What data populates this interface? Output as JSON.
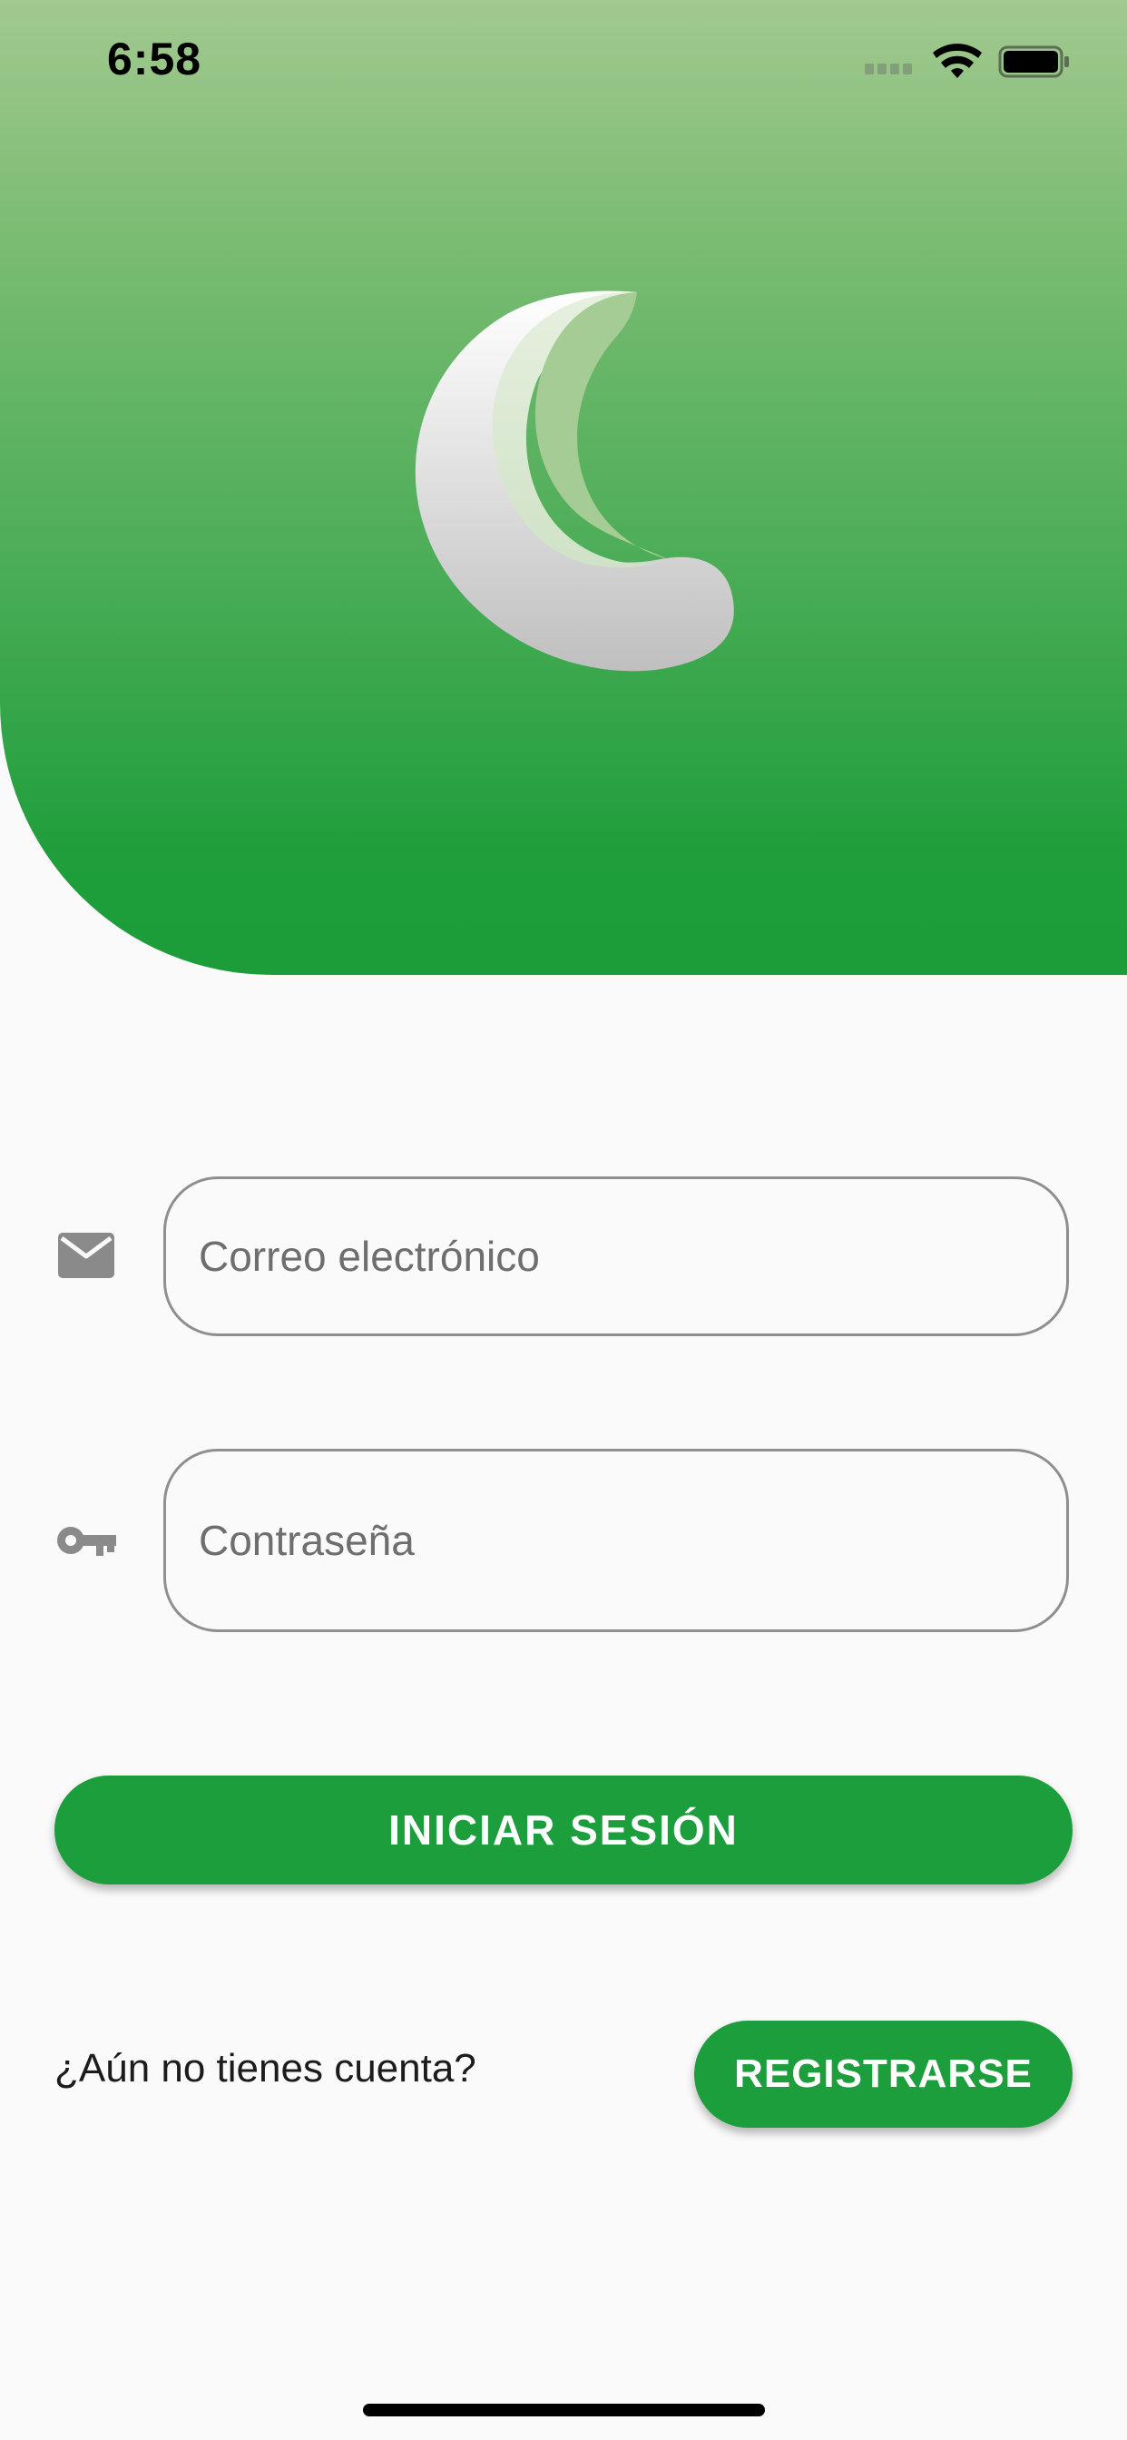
{
  "status_bar": {
    "time": "6:58",
    "icons": [
      "cellular-signal-icon",
      "wifi-icon",
      "battery-icon"
    ]
  },
  "header": {
    "logo": "crescent-moon-logo",
    "gradient_colors": [
      "#a2c98f",
      "#1c9d3a"
    ]
  },
  "form": {
    "email": {
      "icon": "mail-icon",
      "placeholder": "Correo electrónico",
      "value": ""
    },
    "password": {
      "icon": "key-icon",
      "placeholder": "Contraseña",
      "value": ""
    },
    "login_label": "INICIAR SESIÓN"
  },
  "signup": {
    "prompt": "¿Aún no tienes cuenta?",
    "button_label": "REGISTRARSE"
  },
  "colors": {
    "accent": "#1b9e3b",
    "background": "#fafafa",
    "icon": "#8a8a8a"
  }
}
